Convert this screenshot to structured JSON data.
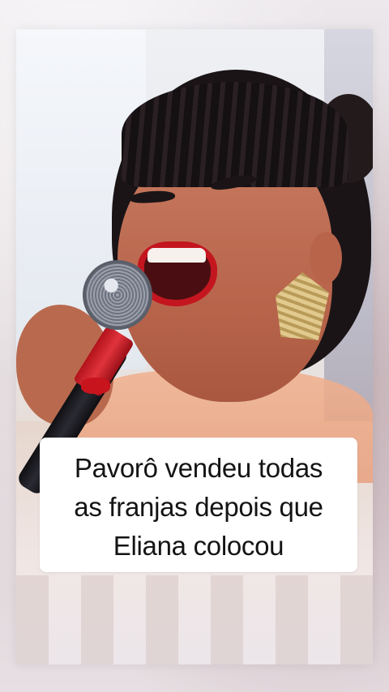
{
  "caption": {
    "line1": "Pavorô vendeu todas",
    "line2": "as franjas depois que",
    "line3": "Eliana colocou"
  },
  "colors": {
    "caption_bg": "#ffffff",
    "caption_text": "#141414",
    "lipstick": "#c4161f",
    "mic_band": "#e0333b"
  },
  "icons": [
    "microphone",
    "earring"
  ]
}
